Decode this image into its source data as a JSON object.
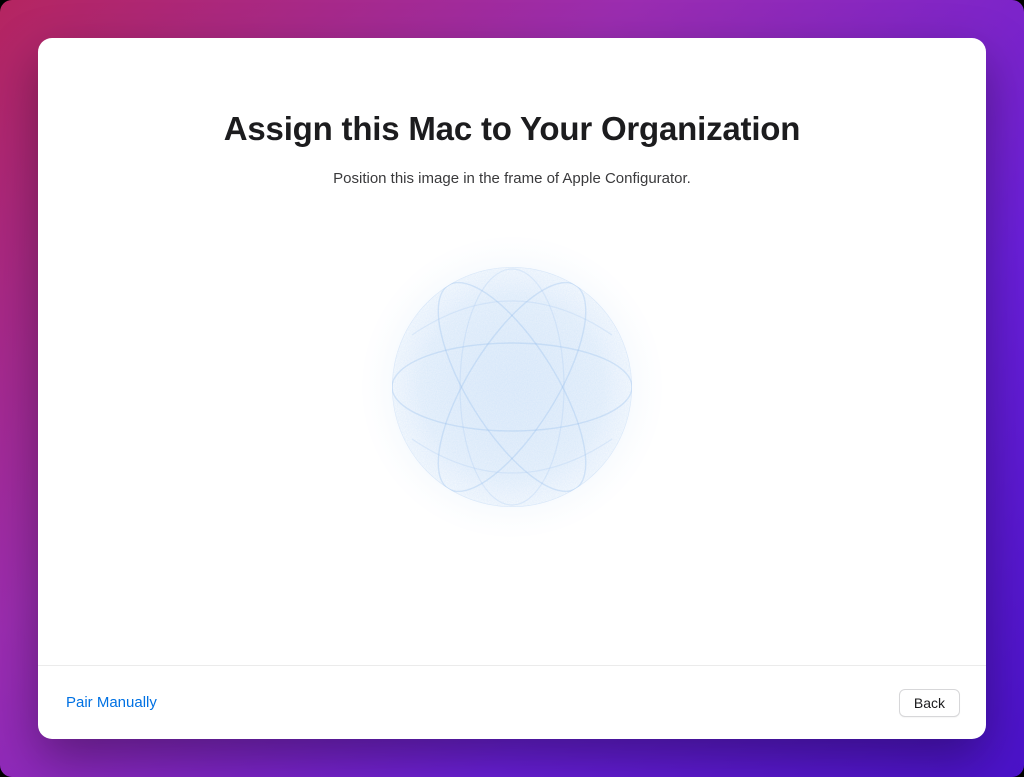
{
  "header": {
    "title": "Assign this Mac to Your Organization",
    "subtitle": "Position this image in the frame of Apple Configurator."
  },
  "footer": {
    "pair_manually_label": "Pair Manually",
    "back_label": "Back"
  },
  "colors": {
    "accent_link": "#0071e3",
    "orb_blue": "#3f7fe0"
  }
}
